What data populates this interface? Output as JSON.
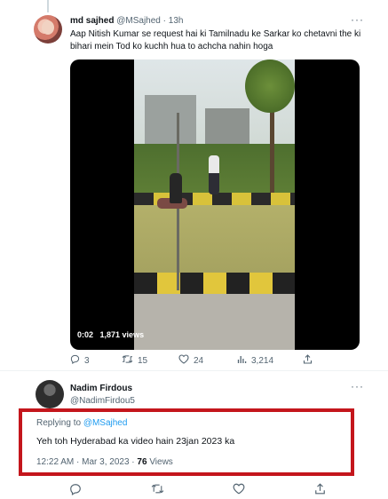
{
  "tweet1": {
    "name": "md sajhed",
    "handle": "@MSajhed",
    "separator": "·",
    "time": "13h",
    "more": "···",
    "text": "Aap Nitish Kumar se request hai ki Tamilnadu ke Sarkar ko chetavni the ki bihari mein Tod ko kuchh hua to achcha nahin hoga",
    "video": {
      "duration": "0:02",
      "views": "1,871 views"
    },
    "actions": {
      "reply_icon": "reply-icon",
      "replies": "3",
      "retweet_icon": "retweet-icon",
      "retweets": "15",
      "like_icon": "like-icon",
      "likes": "24",
      "views_icon": "views-icon",
      "views": "3,214",
      "share_icon": "share-icon"
    }
  },
  "tweet2": {
    "name": "Nadim Firdous",
    "handle": "@NadimFirdou5",
    "more": "···",
    "replying_prefix": "Replying to",
    "replying_to": "@MSajhed",
    "text": "Yeh toh Hyderabad ka video hain 23jan 2023 ka",
    "timestamp": "12:22 AM · Mar 3, 2023 ·",
    "views_count": "76",
    "views_label": "Views"
  },
  "colors": {
    "highlight_border": "#c4161c",
    "link": "#1d9bf0",
    "muted": "#536471"
  }
}
